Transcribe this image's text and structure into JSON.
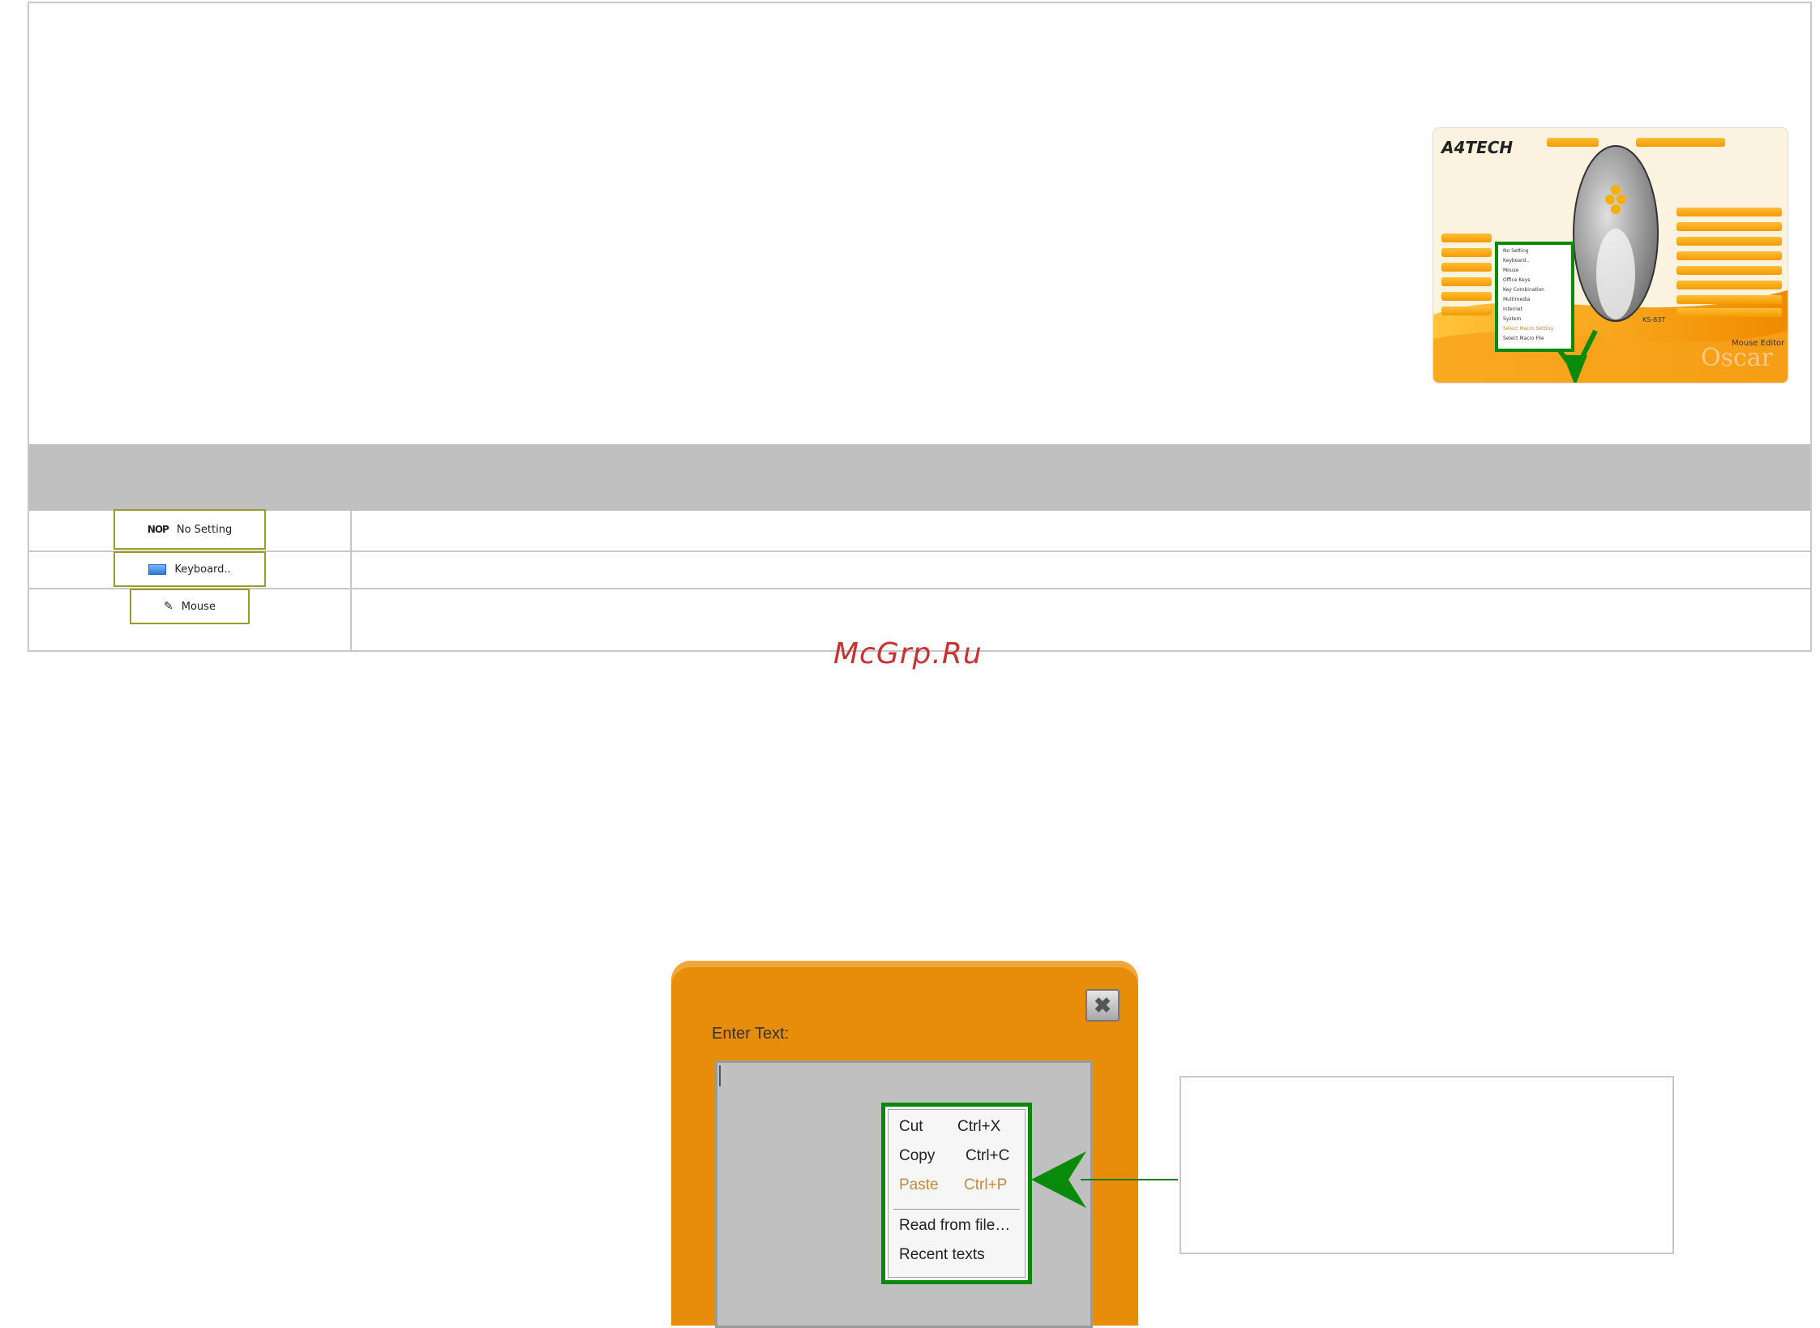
{
  "options": [
    {
      "icon": "NOP",
      "label": "No Setting"
    },
    {
      "icon": "keyboard-icon",
      "label": "Keyboard.."
    },
    {
      "icon": "mouse-icon",
      "label": "Mouse"
    }
  ],
  "thumbnail": {
    "brand": "A4TECH",
    "model": "KS-83T",
    "product_line": "Mouse Editor",
    "product_name": "Oscar",
    "menu_items": [
      "No Setting",
      "Keyboard..",
      "Mouse",
      "Office Keys",
      "Key Combination",
      "Multimedia",
      "Internet",
      "System",
      "Select Macro Setting",
      "Select Macro File"
    ]
  },
  "watermark": "McGrp.Ru",
  "dialog": {
    "label": "Enter Text:",
    "close_symbol": "✖",
    "context_menu": [
      {
        "label": "Cut",
        "shortcut": "Ctrl+X",
        "enabled": true
      },
      {
        "label": "Copy",
        "shortcut": "Ctrl+C",
        "enabled": true
      },
      {
        "label": "Paste",
        "shortcut": "Ctrl+P",
        "enabled": false
      },
      {
        "label": "Read from file…",
        "shortcut": "",
        "enabled": true
      },
      {
        "label": "Recent texts",
        "shortcut": "",
        "enabled": true
      }
    ]
  },
  "colors": {
    "highlight_green": "#0a8a0a",
    "dialog_orange": "#e88d0a",
    "table_header_gray": "#c0c0c0",
    "watermark_red": "#c83232"
  }
}
